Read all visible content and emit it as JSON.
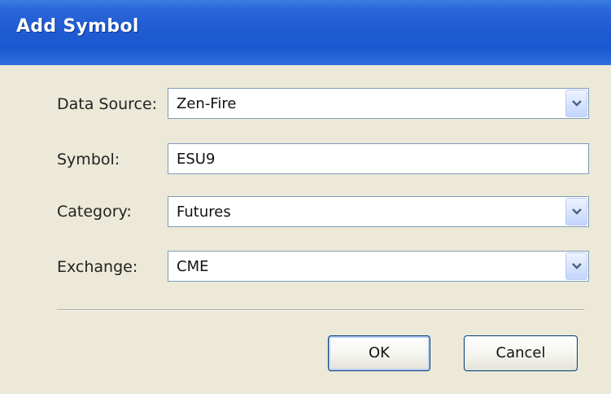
{
  "window": {
    "title": "Add Symbol"
  },
  "form": {
    "data_source": {
      "label": "Data Source:",
      "value": "Zen-Fire"
    },
    "symbol": {
      "label": "Symbol:",
      "value": "ESU9"
    },
    "category": {
      "label": "Category:",
      "value": "Futures"
    },
    "exchange": {
      "label": "Exchange:",
      "value": "CME"
    }
  },
  "buttons": {
    "ok": "OK",
    "cancel": "Cancel"
  },
  "icons": {
    "dropdown": "chevron-down-icon"
  },
  "colors": {
    "titlebar": "#1f5cd4",
    "dialog_background": "#ece9d8",
    "field_border": "#7f9db9",
    "button_border": "#003c74"
  }
}
